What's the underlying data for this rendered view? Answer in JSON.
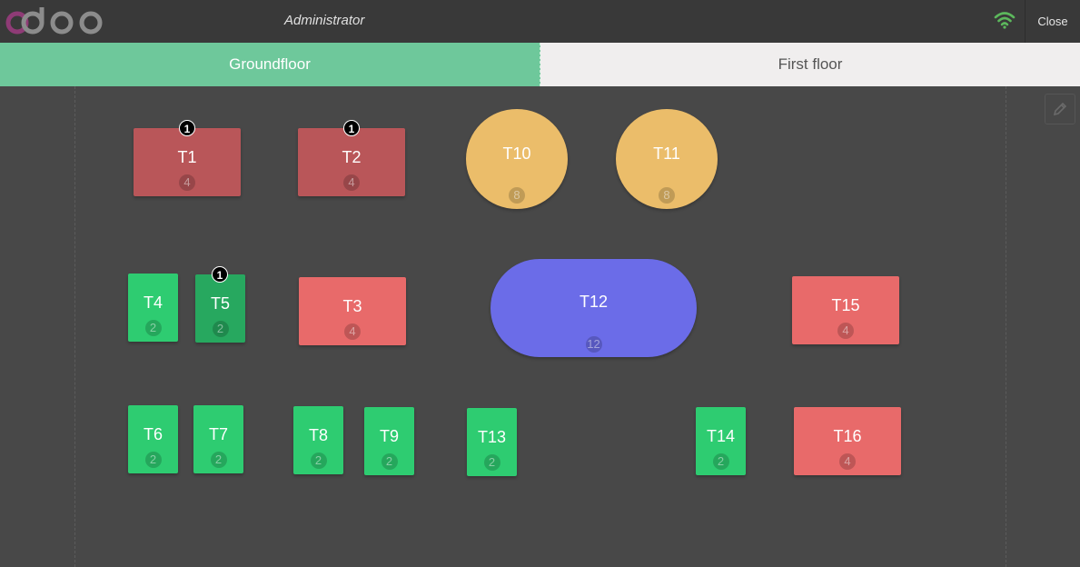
{
  "header": {
    "user": "Administrator",
    "close_label": "Close",
    "logo_icon": "odoo-logo",
    "wifi_icon": "wifi-icon",
    "wifi_color": "#5cb85c"
  },
  "floors": [
    {
      "label": "Groundfloor",
      "active": true,
      "color": "#6ec89b"
    },
    {
      "label": "First floor",
      "active": false,
      "color": "#f0eeee"
    }
  ],
  "colors": {
    "busy": "#b95659",
    "free": "#2ecc71",
    "selected": "#27a85f",
    "reserved": "#e86a6a",
    "round": "#ebbd6a",
    "large": "#6b6ce8"
  },
  "edit_icon": "pencil-icon",
  "tables": [
    {
      "name": "T1",
      "seats": "4",
      "orders": "1"
    },
    {
      "name": "T2",
      "seats": "4",
      "orders": "1"
    },
    {
      "name": "T10",
      "seats": "8"
    },
    {
      "name": "T11",
      "seats": "8"
    },
    {
      "name": "T4",
      "seats": "2"
    },
    {
      "name": "T5",
      "seats": "2",
      "orders": "1"
    },
    {
      "name": "T3",
      "seats": "4"
    },
    {
      "name": "T12",
      "seats": "12"
    },
    {
      "name": "T15",
      "seats": "4"
    },
    {
      "name": "T6",
      "seats": "2"
    },
    {
      "name": "T7",
      "seats": "2"
    },
    {
      "name": "T8",
      "seats": "2"
    },
    {
      "name": "T9",
      "seats": "2"
    },
    {
      "name": "T13",
      "seats": "2"
    },
    {
      "name": "T14",
      "seats": "2"
    },
    {
      "name": "T16",
      "seats": "4"
    }
  ]
}
